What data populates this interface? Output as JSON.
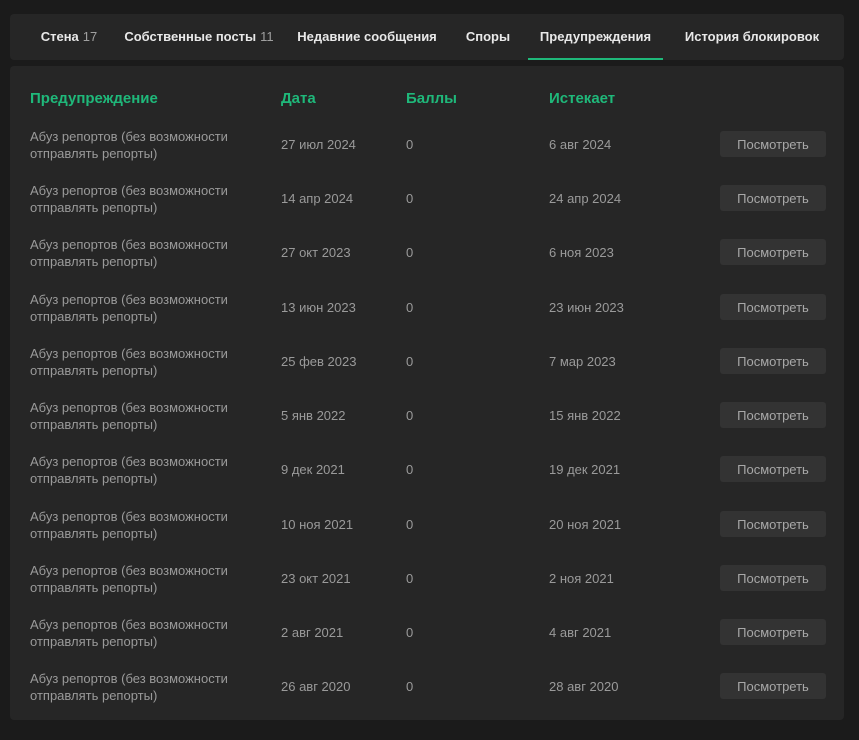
{
  "tabs": [
    {
      "label": "Стена",
      "count": "17"
    },
    {
      "label": "Собственные посты",
      "count": "11"
    },
    {
      "label": "Недавние сообщения",
      "count": ""
    },
    {
      "label": "Споры",
      "count": ""
    },
    {
      "label": "Предупреждения",
      "count": ""
    },
    {
      "label": "История блокировок",
      "count": ""
    }
  ],
  "active_tab": "Предупреждения",
  "accent_color": "#1fb87a",
  "table": {
    "headers": {
      "warning": "Предупреждение",
      "date": "Дата",
      "points": "Баллы",
      "expires": "Истекает"
    },
    "view_label": "Посмотреть",
    "rows": [
      {
        "reason": "Абуз репортов (без возможности отправлять репорты)",
        "date": "27 июл 2024",
        "points": "0",
        "expires": "6 авг 2024"
      },
      {
        "reason": "Абуз репортов (без возможности отправлять репорты)",
        "date": "14 апр 2024",
        "points": "0",
        "expires": "24 апр 2024"
      },
      {
        "reason": "Абуз репортов (без возможности отправлять репорты)",
        "date": "27 окт 2023",
        "points": "0",
        "expires": "6 ноя 2023"
      },
      {
        "reason": "Абуз репортов (без возможности отправлять репорты)",
        "date": "13 июн 2023",
        "points": "0",
        "expires": "23 июн 2023"
      },
      {
        "reason": "Абуз репортов (без возможности отправлять репорты)",
        "date": "25 фев 2023",
        "points": "0",
        "expires": "7 мар 2023"
      },
      {
        "reason": "Абуз репортов (без возможности отправлять репорты)",
        "date": "5 янв 2022",
        "points": "0",
        "expires": "15 янв 2022"
      },
      {
        "reason": "Абуз репортов (без возможности отправлять репорты)",
        "date": "9 дек 2021",
        "points": "0",
        "expires": "19 дек 2021"
      },
      {
        "reason": "Абуз репортов (без возможности отправлять репорты)",
        "date": "10 ноя 2021",
        "points": "0",
        "expires": "20 ноя 2021"
      },
      {
        "reason": "Абуз репортов (без возможности отправлять репорты)",
        "date": "23 окт 2021",
        "points": "0",
        "expires": "2 ноя 2021"
      },
      {
        "reason": "Абуз репортов (без возможности отправлять репорты)",
        "date": "2 авг 2021",
        "points": "0",
        "expires": "4 авг 2021"
      },
      {
        "reason": "Абуз репортов (без возможности отправлять репорты)",
        "date": "26 авг 2020",
        "points": "0",
        "expires": "28 авг 2020"
      }
    ]
  }
}
